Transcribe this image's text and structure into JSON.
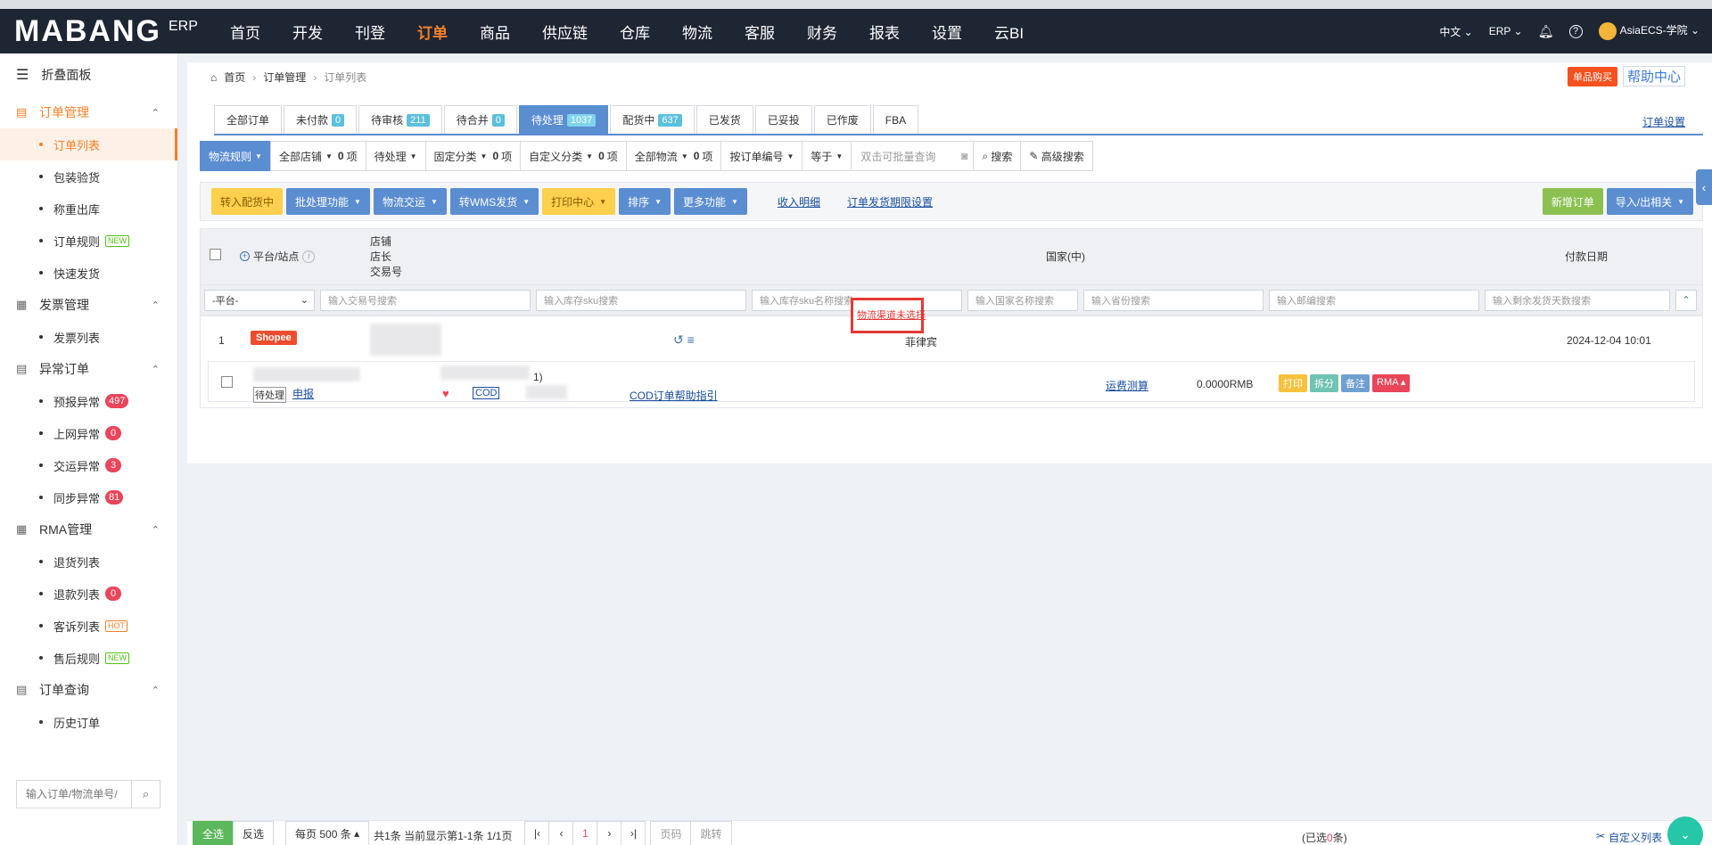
{
  "topnav": {
    "brand": "MABANG",
    "erp": "ERP",
    "items": [
      "首页",
      "开发",
      "刊登",
      "订单",
      "商品",
      "供应链",
      "仓库",
      "物流",
      "客服",
      "财务",
      "报表",
      "设置",
      "云BI"
    ],
    "active_index": 3,
    "lang": "中文",
    "erp_menu": "ERP",
    "user": "AsiaECS-学院"
  },
  "sidebar": {
    "collapse": "折叠面板",
    "groups": [
      {
        "label": "订单管理",
        "active": true,
        "items": [
          {
            "label": "订单列表",
            "active": true
          },
          {
            "label": "包装验货"
          },
          {
            "label": "称重出库"
          },
          {
            "label": "订单规则",
            "tag": "NEW"
          },
          {
            "label": "快速发货"
          }
        ]
      },
      {
        "label": "发票管理",
        "items": [
          {
            "label": "发票列表"
          }
        ]
      },
      {
        "label": "异常订单",
        "items": [
          {
            "label": "预报异常",
            "badge": "497"
          },
          {
            "label": "上网异常",
            "badge": "0"
          },
          {
            "label": "交运异常",
            "badge": "3"
          },
          {
            "label": "同步异常",
            "badge": "81"
          }
        ]
      },
      {
        "label": "RMA管理",
        "items": [
          {
            "label": "退货列表"
          },
          {
            "label": "退款列表",
            "badge": "0"
          },
          {
            "label": "客诉列表",
            "tag": "HOT"
          },
          {
            "label": "售后规则",
            "tag": "NEW"
          }
        ]
      },
      {
        "label": "订单查询",
        "items": [
          {
            "label": "历史订单"
          }
        ]
      }
    ],
    "search_placeholder": "输入订单/物流单号/"
  },
  "breadcrumb": {
    "home": "首页",
    "level1": "订单管理",
    "current": "订单列表"
  },
  "topbtns": {
    "buy": "单品购买",
    "help": "帮助中心"
  },
  "tabs": [
    {
      "label": "全部订单"
    },
    {
      "label": "未付款",
      "count": "0"
    },
    {
      "label": "待审核",
      "count": "211"
    },
    {
      "label": "待合并",
      "count": "0"
    },
    {
      "label": "待处理",
      "count": "1037",
      "active": true
    },
    {
      "label": "配货中",
      "count": "637"
    },
    {
      "label": "已发货"
    },
    {
      "label": "已妥投"
    },
    {
      "label": "已作废"
    },
    {
      "label": "FBA"
    }
  ],
  "order_settings": "订单设置",
  "filters": {
    "logistics_rule": "物流规则",
    "all_shops": "全部店铺",
    "all_shops_n": "0",
    "unit": "项",
    "pending": "待处理",
    "fixed_cat": "固定分类",
    "fixed_cat_n": "0",
    "custom_cat": "自定义分类",
    "custom_cat_n": "0",
    "all_logistics": "全部物流",
    "all_logistics_n": "0",
    "by_order_no": "按订单编号",
    "equals": "等于",
    "query_placeholder": "双击可批量查询",
    "search": "搜索",
    "advanced": "高级搜索"
  },
  "actions": {
    "to_alloc": "转入配货中",
    "batch": "批处理功能",
    "ship": "物流交运",
    "wms": "转WMS发货",
    "print": "打印中心",
    "sort": "排序",
    "more": "更多功能",
    "income": "收入明细",
    "deadline": "订单发货期限设置",
    "new_order": "新增订单",
    "import_export": "导入/出相关"
  },
  "table_head": {
    "platform": "平台/站点",
    "shop": "店铺",
    "owner": "店长",
    "trade_no": "交易号",
    "country": "国家(中)",
    "paydate": "付款日期"
  },
  "search_row": {
    "platform": "-平台-",
    "trade": "输入交易号搜索",
    "sku": "输入库存sku搜索",
    "sku_name": "输入库存sku名称搜索",
    "country": "输入国家名称搜索",
    "province": "输入省份搜索",
    "zip": "输入邮编搜索",
    "days": "输入剩余发货天数搜索"
  },
  "order": {
    "num": "1",
    "platform": "Shopee",
    "country": "菲律宾",
    "paydate": "2024-12-04 10:01",
    "status": "待处理",
    "report": "申报",
    "cod": "COD",
    "qty": "1)",
    "cod_help": "COD订单帮助指引",
    "logistics_unselected": "物流渠道未选择",
    "freight": "运费测算",
    "amount": "0.0000RMB",
    "ops": [
      "打印",
      "拆分",
      "备注",
      "RMA"
    ]
  },
  "bottom": {
    "select_all": "全选",
    "invert": "反选",
    "per_page": "每页 500 条",
    "summary": "共1条 当前显示第1-1条 1/1页",
    "page": "1",
    "page_code": "页码",
    "jump": "跳转",
    "selected_pre": "(已选",
    "selected_n": "0",
    "selected_post": "条)",
    "custom_cols": "自定义列表"
  },
  "colors": {
    "nav_bg": "#1e2533",
    "accent": "#f4812a",
    "primary": "#5b8dd1",
    "danger": "#e53935"
  }
}
